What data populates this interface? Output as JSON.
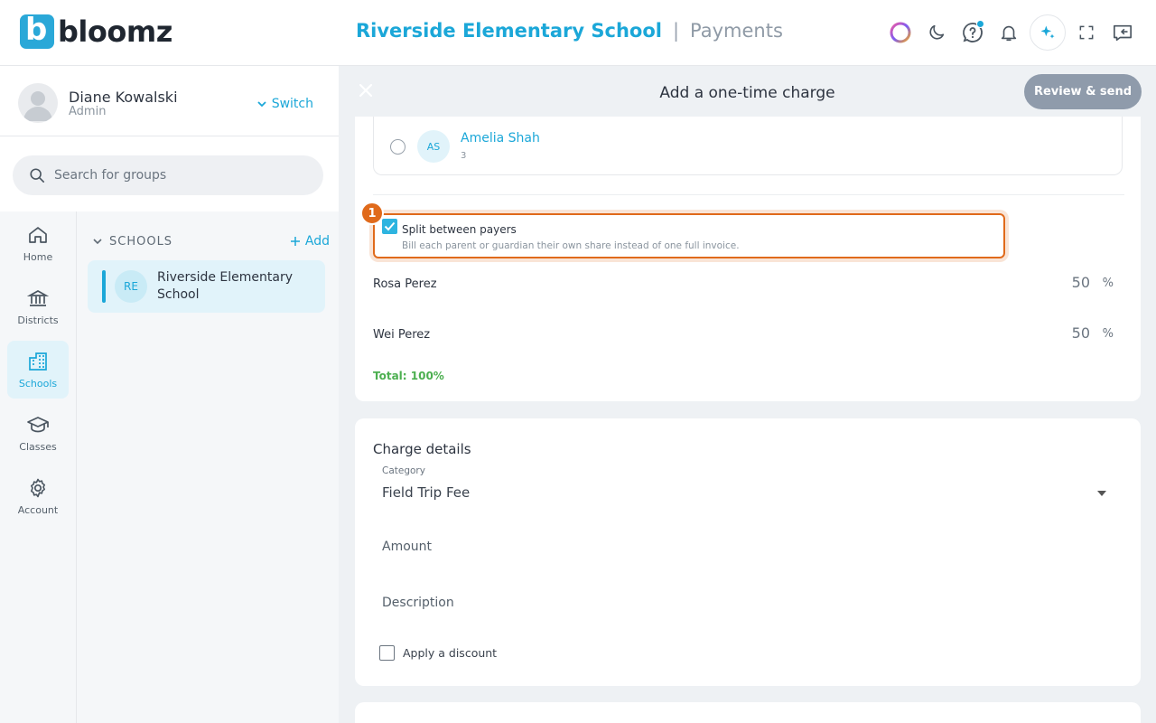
{
  "brand": {
    "logo_letter": "b",
    "name": "bloomz"
  },
  "header": {
    "school": "Riverside Elementary School",
    "separator": "|",
    "section": "Payments"
  },
  "user": {
    "name": "Diane Kowalski",
    "role": "Admin",
    "switch_label": "Switch"
  },
  "search": {
    "placeholder": "Search for groups"
  },
  "rail": [
    {
      "label": "Home",
      "icon": "home-icon"
    },
    {
      "label": "Districts",
      "icon": "bank-icon"
    },
    {
      "label": "Schools",
      "icon": "building-icon"
    },
    {
      "label": "Classes",
      "icon": "graduation-cap-icon"
    },
    {
      "label": "Account",
      "icon": "gear-icon"
    }
  ],
  "groups": {
    "heading": "SCHOOLS",
    "add_label": "Add",
    "items": [
      {
        "initials": "RE",
        "name": "Riverside Elementary School"
      }
    ]
  },
  "dialog": {
    "title": "Add a one-time charge",
    "review_label": "Review & send"
  },
  "student": {
    "initials": "AS",
    "name": "Amelia Shah",
    "grade": "3"
  },
  "split": {
    "step": "1",
    "title": "Split between payers",
    "subtitle": "Bill each parent or guardian their own share instead of one full invoice.",
    "checked": true
  },
  "payers": [
    {
      "name": "Rosa Perez",
      "percent": "50",
      "unit": "%"
    },
    {
      "name": "Wei Perez",
      "percent": "50",
      "unit": "%"
    }
  ],
  "total_label": "Total: 100%",
  "charge": {
    "title": "Charge details",
    "category_label": "Category",
    "category_value": "Field Trip Fee",
    "amount_label": "Amount",
    "description_label": "Description",
    "discount_label": "Apply a discount"
  },
  "colors": {
    "accent": "#1ba7d8",
    "highlight": "#e06a1b",
    "success": "#4caf50",
    "button_disabled": "#8f9bab"
  }
}
